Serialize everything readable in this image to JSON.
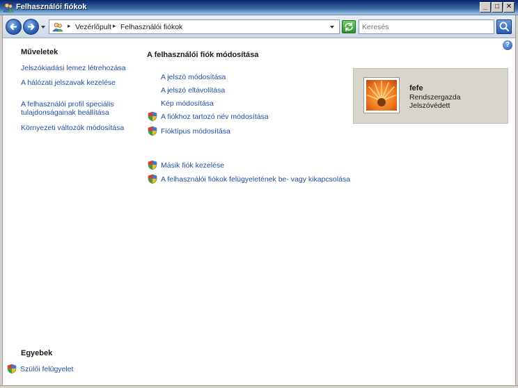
{
  "window": {
    "title": "Felhasználói fiókok",
    "icon": "users-icon",
    "minimize_label": "_",
    "maximize_label": "□",
    "close_label": "✕"
  },
  "toolbar": {
    "breadcrumbs": [
      "Vezérlőpult",
      "Felhasználói fiókok"
    ],
    "breadcrumb_separator": "▸",
    "search_placeholder": "Keresés",
    "search_value": ""
  },
  "help_label": "?",
  "sidebar": {
    "tasks_heading": "Műveletek",
    "tasks": [
      "Jelszókiadási lemez létrehozása",
      "A hálózati jelszavak kezelése",
      "A felhasználói profil speciális tulajdonságainak beállítása",
      "Környezeti változók módosítása"
    ],
    "other_heading": "Egyebek",
    "other": [
      {
        "label": "Szülői felügyelet",
        "icon": "shield-icon"
      }
    ]
  },
  "main": {
    "heading": "A felhasználói fiók módosítása",
    "tasks": [
      {
        "label": "A jelszó módosítása",
        "shield": false
      },
      {
        "label": "A jelszó eltávolítása",
        "shield": false
      },
      {
        "label": "Kép módosítása",
        "shield": false
      },
      {
        "label": "A fiókhoz tartozó név módosítása",
        "shield": true
      },
      {
        "label": "Fióktípus módosítása",
        "shield": true
      }
    ],
    "extra_tasks": [
      {
        "label": "Másik fiók kezelése",
        "shield": true
      },
      {
        "label": "A felhasználói fiókok felügyeletének be- vagy kikapcsolása",
        "shield": true
      }
    ]
  },
  "user": {
    "name": "fefe",
    "role": "Rendszergazda",
    "status": "Jelszóvédett",
    "picture": "orange-flower-picture"
  }
}
